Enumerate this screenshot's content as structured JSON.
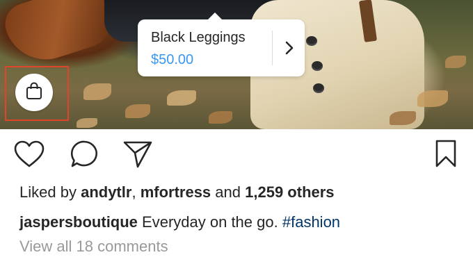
{
  "post": {
    "photo": {
      "product_tag": {
        "title": "Black Leggings",
        "price": "$50.00",
        "chevron_icon": "chevron-right-icon"
      },
      "shopping_bag_icon": "shopping-bag-icon"
    },
    "actions": {
      "like_icon": "heart-icon",
      "comment_icon": "comment-bubble-icon",
      "share_icon": "paper-plane-icon",
      "save_icon": "bookmark-icon"
    },
    "likes": {
      "prefix": "Liked by",
      "user1": "andytlr",
      "separator": ",",
      "user2": "mfortress",
      "conjunction": "and",
      "others": "1,259 others"
    },
    "caption": {
      "username": "jaspersboutique",
      "text": "Everyday on the go.",
      "hashtag": "#fashion"
    },
    "comments_link": "View all 18 comments"
  },
  "colors": {
    "link_blue": "#3897f0",
    "hashtag_blue": "#003569",
    "highlight_red": "#e0452b",
    "muted_gray": "#999999",
    "text_dark": "#262626"
  }
}
